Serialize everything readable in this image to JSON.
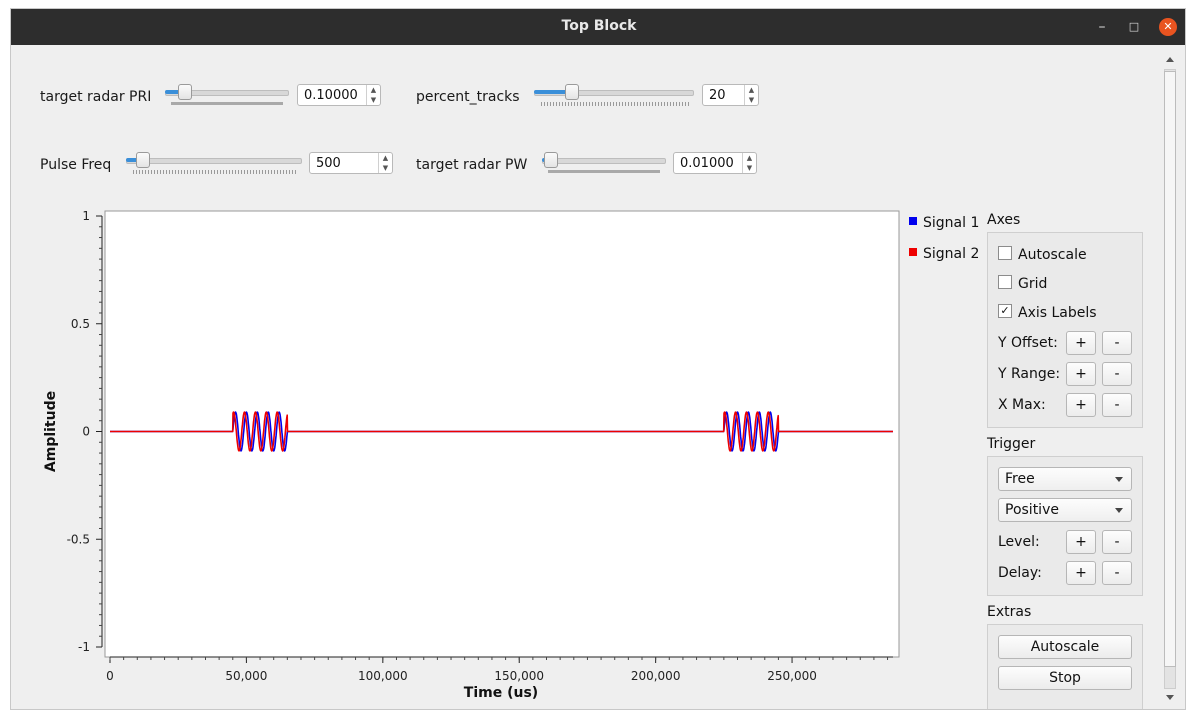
{
  "window": {
    "title": "Top Block"
  },
  "controls": {
    "pri": {
      "label": "target radar PRI",
      "value": "0.10000",
      "level": 0.1
    },
    "percent_tracks": {
      "label": "percent_tracks",
      "value": "20",
      "level": 0.2
    },
    "pulse_freq": {
      "label": "Pulse Freq",
      "value": "500",
      "level": 0.05
    },
    "pw": {
      "label": "target radar PW",
      "value": "0.01000",
      "level": 0.0
    }
  },
  "legend": [
    {
      "name": "Signal 1",
      "color": "#0000ee"
    },
    {
      "name": "Signal 2",
      "color": "#ee0000"
    }
  ],
  "panel": {
    "axes": {
      "title": "Axes",
      "autoscale": "Autoscale",
      "grid": "Grid",
      "axis_labels": "Axis Labels",
      "axis_labels_checked": "✓",
      "y_offset": "Y Offset:",
      "y_range": "Y Range:",
      "x_max": "X Max:"
    },
    "trigger": {
      "title": "Trigger",
      "mode": "Free",
      "slope": "Positive",
      "level": "Level:",
      "delay": "Delay:"
    },
    "extras": {
      "title": "Extras",
      "autoscale_button": "Autoscale",
      "stop_button": "Stop"
    },
    "plus": "+",
    "minus": "-"
  },
  "chart_data": {
    "type": "line",
    "xlabel": "Time (us)",
    "ylabel": "Amplitude",
    "xlim": [
      0,
      287000
    ],
    "ylim": [
      -1,
      1
    ],
    "x_ticks": [
      0,
      50000,
      100000,
      150000,
      200000,
      250000
    ],
    "x_tick_labels": [
      "0",
      "50,000",
      "100,000",
      "150,000",
      "200,000",
      "250,000"
    ],
    "y_ticks": [
      1,
      0.5,
      0,
      -0.5,
      -1
    ],
    "y_tick_labels": [
      "1",
      "0.5",
      "0",
      "-0.5",
      "-1"
    ],
    "grid": false,
    "legend_position": "right",
    "series": [
      {
        "name": "Signal 1",
        "color": "#0000ee",
        "baseline": 0,
        "bursts": [
          {
            "start": 45000,
            "end": 65000,
            "amplitude": 0.09,
            "cycles": 5
          },
          {
            "start": 225000,
            "end": 245000,
            "amplitude": 0.09,
            "cycles": 5
          }
        ]
      },
      {
        "name": "Signal 2",
        "color": "#ee0000",
        "baseline": 0,
        "bursts": [
          {
            "start": 45000,
            "end": 65000,
            "amplitude": 0.09,
            "cycles": 5
          },
          {
            "start": 225000,
            "end": 245000,
            "amplitude": 0.09,
            "cycles": 5
          }
        ]
      }
    ]
  }
}
